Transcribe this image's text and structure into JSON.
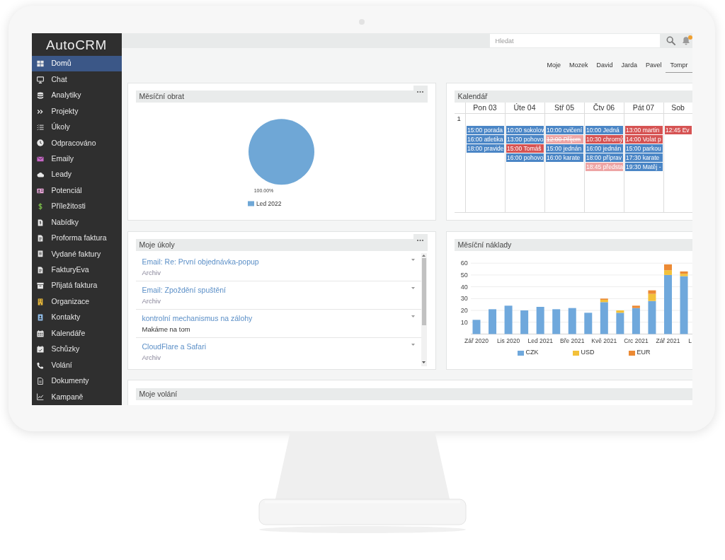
{
  "sidebar": {
    "logo": "AutoCRM",
    "items": [
      {
        "label": "Domů",
        "selected": true
      },
      {
        "label": "Chat",
        "selected": false
      },
      {
        "label": "Analytiky",
        "selected": false
      },
      {
        "label": "Projekty",
        "selected": false
      },
      {
        "label": "Úkoly",
        "selected": false
      },
      {
        "label": "Odpracováno",
        "selected": false
      },
      {
        "label": "Emaily",
        "selected": false
      },
      {
        "label": "Leady",
        "selected": false
      },
      {
        "label": "Potenciál",
        "selected": false
      },
      {
        "label": "Příležitosti",
        "selected": false
      },
      {
        "label": "Nabídky",
        "selected": false
      },
      {
        "label": "Proforma faktura",
        "selected": false
      },
      {
        "label": "Vydané faktury",
        "selected": false
      },
      {
        "label": "FakturyEva",
        "selected": false
      },
      {
        "label": "Přijatá faktura",
        "selected": false
      },
      {
        "label": "Organizace",
        "selected": false
      },
      {
        "label": "Kontakty",
        "selected": false
      },
      {
        "label": "Kalendáře",
        "selected": false
      },
      {
        "label": "Schůzky",
        "selected": false
      },
      {
        "label": "Volání",
        "selected": false
      },
      {
        "label": "Dokumenty",
        "selected": false
      },
      {
        "label": "Kampaně",
        "selected": false
      }
    ]
  },
  "top_bar": {
    "search": {
      "placeholder": "Hledat"
    },
    "notifications": {
      "unread": true
    }
  },
  "user_tabs": [
    {
      "label": "Moje",
      "selected": false
    },
    {
      "label": "Mozek",
      "selected": false
    },
    {
      "label": "David",
      "selected": false
    },
    {
      "label": "Jarda",
      "selected": false
    },
    {
      "label": "Pavel",
      "selected": false
    },
    {
      "label": "Tompr",
      "selected": true
    }
  ],
  "revenue_panel": {
    "title": "Měsíční obrat",
    "menu": true,
    "chart_data": {
      "type": "pie",
      "categories": [
        "Led 2022"
      ],
      "values": [
        100
      ],
      "value_labels": [
        "100.00%"
      ],
      "legend": "bottom"
    }
  },
  "calendar_panel": {
    "title": "Kalendář",
    "menu": false,
    "row_label": "1",
    "days": [
      {
        "label": "Pon 03",
        "events": [
          {
            "text": "15:00 porada",
            "color": "#4b86c6",
            "cancelled": false
          },
          {
            "text": "16:00 atletika",
            "color": "#4b86c6",
            "cancelled": false
          },
          {
            "text": "18:00 pravide",
            "color": "#4b86c6",
            "cancelled": false
          }
        ]
      },
      {
        "label": "Úte 04",
        "events": [
          {
            "text": "10:00 sokolov",
            "color": "#4b86c6",
            "cancelled": false
          },
          {
            "text": "13:00 pohovo",
            "color": "#4b86c6",
            "cancelled": false
          },
          {
            "text": "15:00 Tomáš",
            "color": "#d65353",
            "cancelled": false
          },
          {
            "text": "16:00 pohovo",
            "color": "#4b86c6",
            "cancelled": false
          }
        ]
      },
      {
        "label": "Stř 05",
        "events": [
          {
            "text": "10:00 cvičení",
            "color": "#4b86c6",
            "cancelled": false
          },
          {
            "text": "12:00 Příjem",
            "color": "#eda4a4",
            "cancelled": true
          },
          {
            "text": "15:00 jednán",
            "color": "#4b86c6",
            "cancelled": false
          },
          {
            "text": "16:00 karate",
            "color": "#4b86c6",
            "cancelled": false
          }
        ]
      },
      {
        "label": "Čtv 06",
        "events": [
          {
            "text": "10:00 Jedná",
            "color": "#4b86c6",
            "cancelled": false
          },
          {
            "text": "10:30 chromý",
            "color": "#d65353",
            "cancelled": false
          },
          {
            "text": "16:00 jednán",
            "color": "#4b86c6",
            "cancelled": false
          },
          {
            "text": "18:00 příprav",
            "color": "#4b86c6",
            "cancelled": false
          },
          {
            "text": "18:45 předsta",
            "color": "#eda4a4",
            "cancelled": false
          }
        ]
      },
      {
        "label": "Pát 07",
        "events": [
          {
            "text": "13:00 martin",
            "color": "#d65353",
            "cancelled": false
          },
          {
            "text": "14:00 Volat p",
            "color": "#d65353",
            "cancelled": false
          },
          {
            "text": "15:00 parkou",
            "color": "#4b86c6",
            "cancelled": false
          },
          {
            "text": "17:30 karate",
            "color": "#4b86c6",
            "cancelled": false
          },
          {
            "text": "19:30 Matěj -",
            "color": "#4b86c6",
            "cancelled": false
          }
        ]
      },
      {
        "label": "Sob",
        "events": [
          {
            "text": "12:45 Ev",
            "color": "#d65353",
            "cancelled": false
          }
        ]
      }
    ]
  },
  "tasks_panel": {
    "title": "Moje úkoly",
    "menu": true,
    "items": [
      {
        "title": "Email: Re: První objednávka-popup",
        "status": "Archiv",
        "archived": true
      },
      {
        "title": "Email: Zpoždění spuštění",
        "status": "Archiv",
        "archived": true
      },
      {
        "title": "kontrolní mechanismus na zálohy",
        "status": "Makáme na tom",
        "archived": false
      },
      {
        "title": "CloudFlare a Safari",
        "status": "Archiv",
        "archived": true
      }
    ]
  },
  "costs_panel": {
    "title": "Měsíční náklady",
    "menu": false,
    "chart_data": {
      "type": "bar",
      "stacked": true,
      "grid": true,
      "legend": "bottom",
      "categories": [
        "Zář 2020",
        null,
        "Lis 2020",
        null,
        "Led 2021",
        null,
        "Bře 2021",
        null,
        "Kvě 2021",
        null,
        "Crc 2021",
        null,
        "Zář 2021",
        null,
        "L"
      ],
      "ylim": [
        0,
        60
      ],
      "yticks": [
        10,
        20,
        30,
        40,
        50,
        60
      ],
      "series": [
        {
          "name": "CZK",
          "color": "#6fa8dc",
          "values": [
            12,
            21,
            24,
            20,
            23,
            21,
            22,
            18,
            27,
            18,
            22,
            28,
            50,
            49,
            null
          ]
        },
        {
          "name": "USD",
          "color": "#f3c13a",
          "values": [
            0,
            0,
            0,
            0,
            0,
            0,
            0,
            0,
            2,
            2,
            0,
            6,
            4,
            2,
            null
          ]
        },
        {
          "name": "EUR",
          "color": "#ec8a34",
          "values": [
            0,
            0,
            0,
            0,
            0,
            0,
            0,
            0,
            1,
            0,
            2,
            3,
            5,
            2,
            null
          ]
        }
      ]
    }
  },
  "calls_panel": {
    "title": "Moje volání",
    "menu": false
  }
}
